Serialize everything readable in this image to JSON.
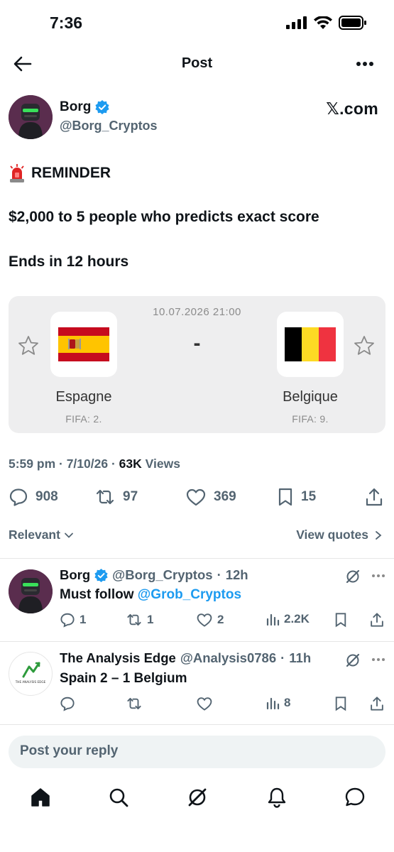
{
  "status_bar": {
    "time": "7:36"
  },
  "header": {
    "title": "Post"
  },
  "author": {
    "name": "Borg",
    "handle": "@Borg_Cryptos",
    "source": "𝕏.com"
  },
  "post": {
    "line1": "REMINDER",
    "line2": "$2,000 to 5 people who predicts exact score",
    "line3": "Ends in 12 hours"
  },
  "match": {
    "datetime": "10.07.2026 21:00",
    "separator": "-",
    "home": {
      "name": "Espagne",
      "fifa": "FIFA: 2."
    },
    "away": {
      "name": "Belgique",
      "fifa": "FIFA: 9."
    }
  },
  "meta": {
    "time": "5:59 pm",
    "date": "7/10/26",
    "views": "63K",
    "views_label": "Views"
  },
  "actions": {
    "replies": "908",
    "reposts": "97",
    "likes": "369",
    "bookmarks": "15"
  },
  "sort": {
    "label": "Relevant",
    "quotes": "View quotes"
  },
  "replies": [
    {
      "name": "Borg",
      "handle": "@Borg_Cryptos",
      "time": "12h",
      "text": "Must follow ",
      "mention": "@Grob_Cryptos",
      "replies": "1",
      "reposts": "1",
      "likes": "2",
      "views": "2.2K"
    },
    {
      "name": "The Analysis Edge",
      "handle": "@Analysis0786",
      "time": "11h",
      "text": "Spain 2 – 1 Belgium",
      "logo_text": "THE ANALYSIS EDGE",
      "replies": "",
      "reposts": "",
      "likes": "",
      "views": "8"
    }
  ],
  "reply_box": {
    "placeholder": "Post your reply"
  },
  "colors": {
    "verified": "#1d9bf0",
    "mention": "#1d9bf0",
    "card_bg": "#eeeeef"
  },
  "icons": [
    "back-arrow-icon",
    "more-icon",
    "verified-badge-icon",
    "siren-icon",
    "star-icon",
    "reply-icon",
    "repost-icon",
    "like-icon",
    "bookmark-icon",
    "share-icon",
    "grok-icon",
    "analytics-icon",
    "home-icon",
    "search-icon",
    "bell-icon",
    "messages-icon"
  ]
}
